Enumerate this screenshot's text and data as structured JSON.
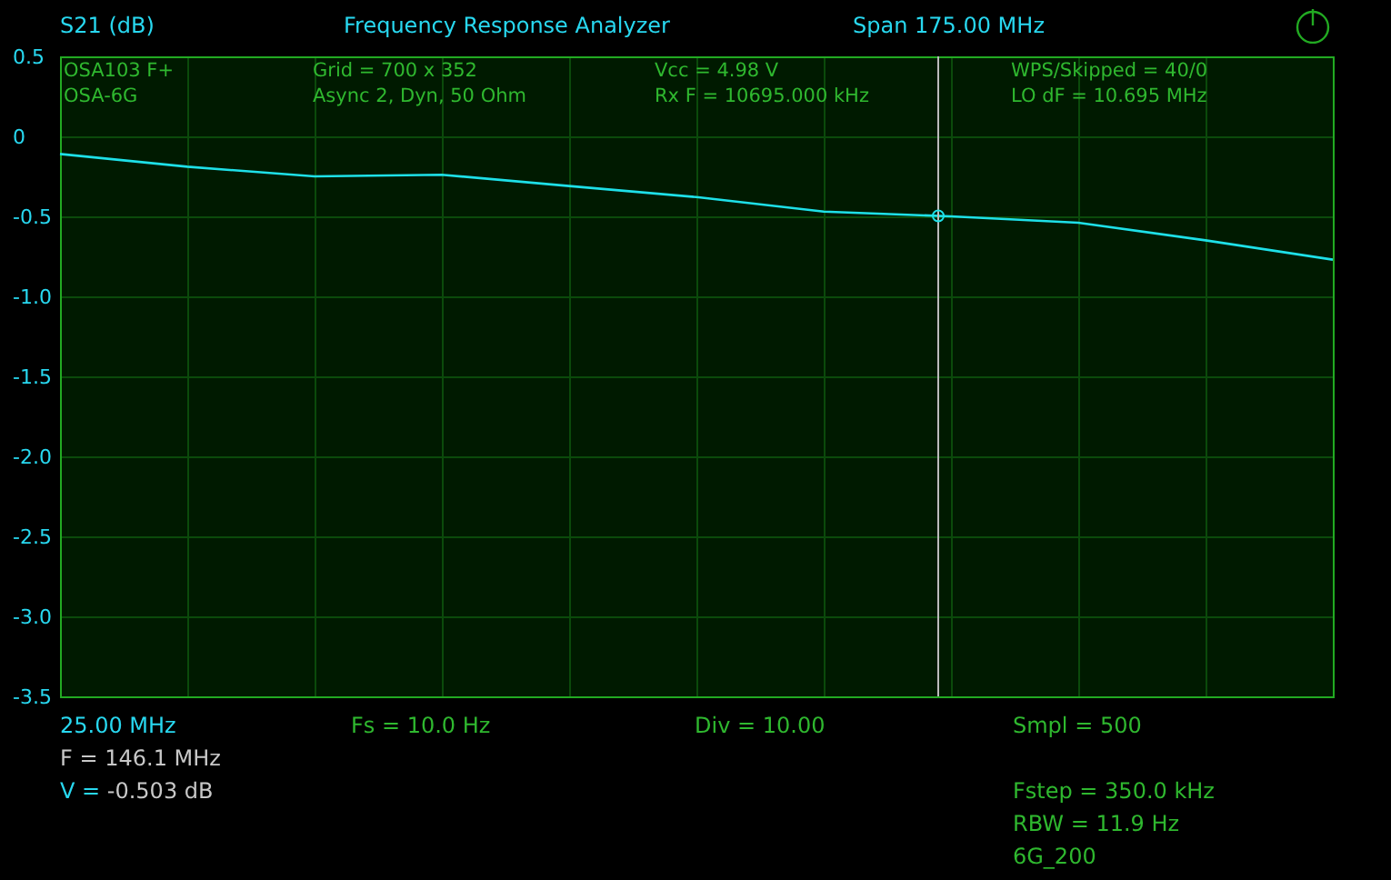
{
  "header": {
    "title": "Frequency Response Analyzer",
    "span": "Span 175.00 MHz"
  },
  "cursor": {
    "level": 0.69
  },
  "info": [
    [
      "OSA103 F+",
      "OSA-6G"
    ],
    [
      "Grid = 700 x 352",
      "Async 2,  Dyn, 50 Ohm"
    ],
    [
      "Vcc = 4.98 V",
      "Rx F = 10695.000 kHz"
    ],
    [
      "WPS/Skipped  = 40/0",
      "LO dF = 10.695 MHz"
    ]
  ],
  "chart_data": {
    "type": "line",
    "ylabel": "S21 (dB)",
    "categories": [
      null,
      null,
      null,
      null,
      null,
      null,
      null,
      null,
      null,
      null,
      null
    ],
    "series": [
      {
        "color": "#1ee0e8",
        "values": [
          -0.11,
          -0.19,
          -0.25,
          -0.24,
          -0.31,
          -0.38,
          -0.47,
          -0.5,
          -0.54,
          -0.65,
          -0.77
        ]
      }
    ],
    "ylim": [
      -3.5,
      0.5
    ],
    "grid": true,
    "yticks": [
      {
        "value": 0.5,
        "label": "0.5"
      },
      {
        "value": 0,
        "label": "0"
      },
      {
        "value": -0.5,
        "label": "-0.5"
      },
      {
        "value": -1,
        "label": "-1.0"
      },
      {
        "value": -1.5,
        "label": "-1.5"
      },
      {
        "value": -2,
        "label": "-2.0"
      },
      {
        "value": -2.5,
        "label": "-2.5"
      },
      {
        "value": -3,
        "label": "-3.0"
      },
      {
        "value": -3.5,
        "label": "-3.5"
      }
    ]
  },
  "footer": {
    "start": "25.00 MHz",
    "fs": "Fs = 10.0 Hz",
    "div": "Div = 10.00",
    "readouts": [
      {
        "label": "F =",
        "value": "146.1 MHz",
        "label_highlight": false
      },
      {
        "label": "V =",
        "value": "-0.503 dB",
        "label_highlight": true
      }
    ],
    "settings": [
      [
        "Smpl = 500"
      ],
      [
        "Fstep = 350.0 kHz",
        "RBW = 11.9 Hz",
        "6G_200"
      ]
    ]
  }
}
